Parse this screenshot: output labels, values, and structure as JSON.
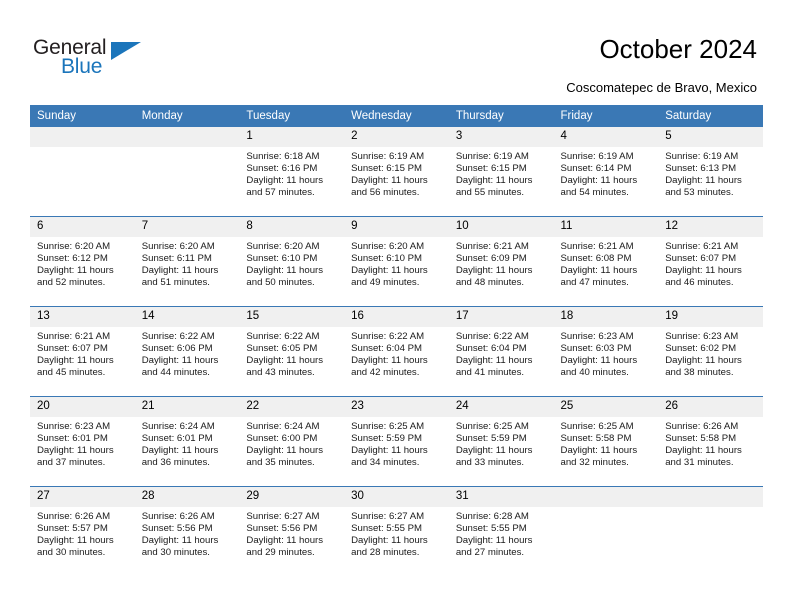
{
  "brand": {
    "name_part1": "General",
    "name_part2": "Blue",
    "accent_color": "#1b75bb"
  },
  "header": {
    "title": "October 2024",
    "subtitle": "Coscomatepec de Bravo, Mexico"
  },
  "calendar": {
    "header_bg": "#3a78b5",
    "date_band_bg": "#f0f0f0",
    "weekdays": [
      "Sunday",
      "Monday",
      "Tuesday",
      "Wednesday",
      "Thursday",
      "Friday",
      "Saturday"
    ],
    "labels": {
      "sunrise": "Sunrise:",
      "sunset": "Sunset:",
      "daylight": "Daylight:"
    },
    "weeks": [
      [
        {
          "day": "",
          "empty": true
        },
        {
          "day": "",
          "empty": true
        },
        {
          "day": "1",
          "sunrise": "Sunrise: 6:18 AM",
          "sunset": "Sunset: 6:16 PM",
          "daylight_line1": "Daylight: 11 hours",
          "daylight_line2": "and 57 minutes."
        },
        {
          "day": "2",
          "sunrise": "Sunrise: 6:19 AM",
          "sunset": "Sunset: 6:15 PM",
          "daylight_line1": "Daylight: 11 hours",
          "daylight_line2": "and 56 minutes."
        },
        {
          "day": "3",
          "sunrise": "Sunrise: 6:19 AM",
          "sunset": "Sunset: 6:15 PM",
          "daylight_line1": "Daylight: 11 hours",
          "daylight_line2": "and 55 minutes."
        },
        {
          "day": "4",
          "sunrise": "Sunrise: 6:19 AM",
          "sunset": "Sunset: 6:14 PM",
          "daylight_line1": "Daylight: 11 hours",
          "daylight_line2": "and 54 minutes."
        },
        {
          "day": "5",
          "sunrise": "Sunrise: 6:19 AM",
          "sunset": "Sunset: 6:13 PM",
          "daylight_line1": "Daylight: 11 hours",
          "daylight_line2": "and 53 minutes."
        }
      ],
      [
        {
          "day": "6",
          "sunrise": "Sunrise: 6:20 AM",
          "sunset": "Sunset: 6:12 PM",
          "daylight_line1": "Daylight: 11 hours",
          "daylight_line2": "and 52 minutes."
        },
        {
          "day": "7",
          "sunrise": "Sunrise: 6:20 AM",
          "sunset": "Sunset: 6:11 PM",
          "daylight_line1": "Daylight: 11 hours",
          "daylight_line2": "and 51 minutes."
        },
        {
          "day": "8",
          "sunrise": "Sunrise: 6:20 AM",
          "sunset": "Sunset: 6:10 PM",
          "daylight_line1": "Daylight: 11 hours",
          "daylight_line2": "and 50 minutes."
        },
        {
          "day": "9",
          "sunrise": "Sunrise: 6:20 AM",
          "sunset": "Sunset: 6:10 PM",
          "daylight_line1": "Daylight: 11 hours",
          "daylight_line2": "and 49 minutes."
        },
        {
          "day": "10",
          "sunrise": "Sunrise: 6:21 AM",
          "sunset": "Sunset: 6:09 PM",
          "daylight_line1": "Daylight: 11 hours",
          "daylight_line2": "and 48 minutes."
        },
        {
          "day": "11",
          "sunrise": "Sunrise: 6:21 AM",
          "sunset": "Sunset: 6:08 PM",
          "daylight_line1": "Daylight: 11 hours",
          "daylight_line2": "and 47 minutes."
        },
        {
          "day": "12",
          "sunrise": "Sunrise: 6:21 AM",
          "sunset": "Sunset: 6:07 PM",
          "daylight_line1": "Daylight: 11 hours",
          "daylight_line2": "and 46 minutes."
        }
      ],
      [
        {
          "day": "13",
          "sunrise": "Sunrise: 6:21 AM",
          "sunset": "Sunset: 6:07 PM",
          "daylight_line1": "Daylight: 11 hours",
          "daylight_line2": "and 45 minutes."
        },
        {
          "day": "14",
          "sunrise": "Sunrise: 6:22 AM",
          "sunset": "Sunset: 6:06 PM",
          "daylight_line1": "Daylight: 11 hours",
          "daylight_line2": "and 44 minutes."
        },
        {
          "day": "15",
          "sunrise": "Sunrise: 6:22 AM",
          "sunset": "Sunset: 6:05 PM",
          "daylight_line1": "Daylight: 11 hours",
          "daylight_line2": "and 43 minutes."
        },
        {
          "day": "16",
          "sunrise": "Sunrise: 6:22 AM",
          "sunset": "Sunset: 6:04 PM",
          "daylight_line1": "Daylight: 11 hours",
          "daylight_line2": "and 42 minutes."
        },
        {
          "day": "17",
          "sunrise": "Sunrise: 6:22 AM",
          "sunset": "Sunset: 6:04 PM",
          "daylight_line1": "Daylight: 11 hours",
          "daylight_line2": "and 41 minutes."
        },
        {
          "day": "18",
          "sunrise": "Sunrise: 6:23 AM",
          "sunset": "Sunset: 6:03 PM",
          "daylight_line1": "Daylight: 11 hours",
          "daylight_line2": "and 40 minutes."
        },
        {
          "day": "19",
          "sunrise": "Sunrise: 6:23 AM",
          "sunset": "Sunset: 6:02 PM",
          "daylight_line1": "Daylight: 11 hours",
          "daylight_line2": "and 38 minutes."
        }
      ],
      [
        {
          "day": "20",
          "sunrise": "Sunrise: 6:23 AM",
          "sunset": "Sunset: 6:01 PM",
          "daylight_line1": "Daylight: 11 hours",
          "daylight_line2": "and 37 minutes."
        },
        {
          "day": "21",
          "sunrise": "Sunrise: 6:24 AM",
          "sunset": "Sunset: 6:01 PM",
          "daylight_line1": "Daylight: 11 hours",
          "daylight_line2": "and 36 minutes."
        },
        {
          "day": "22",
          "sunrise": "Sunrise: 6:24 AM",
          "sunset": "Sunset: 6:00 PM",
          "daylight_line1": "Daylight: 11 hours",
          "daylight_line2": "and 35 minutes."
        },
        {
          "day": "23",
          "sunrise": "Sunrise: 6:25 AM",
          "sunset": "Sunset: 5:59 PM",
          "daylight_line1": "Daylight: 11 hours",
          "daylight_line2": "and 34 minutes."
        },
        {
          "day": "24",
          "sunrise": "Sunrise: 6:25 AM",
          "sunset": "Sunset: 5:59 PM",
          "daylight_line1": "Daylight: 11 hours",
          "daylight_line2": "and 33 minutes."
        },
        {
          "day": "25",
          "sunrise": "Sunrise: 6:25 AM",
          "sunset": "Sunset: 5:58 PM",
          "daylight_line1": "Daylight: 11 hours",
          "daylight_line2": "and 32 minutes."
        },
        {
          "day": "26",
          "sunrise": "Sunrise: 6:26 AM",
          "sunset": "Sunset: 5:58 PM",
          "daylight_line1": "Daylight: 11 hours",
          "daylight_line2": "and 31 minutes."
        }
      ],
      [
        {
          "day": "27",
          "sunrise": "Sunrise: 6:26 AM",
          "sunset": "Sunset: 5:57 PM",
          "daylight_line1": "Daylight: 11 hours",
          "daylight_line2": "and 30 minutes."
        },
        {
          "day": "28",
          "sunrise": "Sunrise: 6:26 AM",
          "sunset": "Sunset: 5:56 PM",
          "daylight_line1": "Daylight: 11 hours",
          "daylight_line2": "and 30 minutes."
        },
        {
          "day": "29",
          "sunrise": "Sunrise: 6:27 AM",
          "sunset": "Sunset: 5:56 PM",
          "daylight_line1": "Daylight: 11 hours",
          "daylight_line2": "and 29 minutes."
        },
        {
          "day": "30",
          "sunrise": "Sunrise: 6:27 AM",
          "sunset": "Sunset: 5:55 PM",
          "daylight_line1": "Daylight: 11 hours",
          "daylight_line2": "and 28 minutes."
        },
        {
          "day": "31",
          "sunrise": "Sunrise: 6:28 AM",
          "sunset": "Sunset: 5:55 PM",
          "daylight_line1": "Daylight: 11 hours",
          "daylight_line2": "and 27 minutes."
        },
        {
          "day": "",
          "empty": true
        },
        {
          "day": "",
          "empty": true
        }
      ]
    ]
  }
}
